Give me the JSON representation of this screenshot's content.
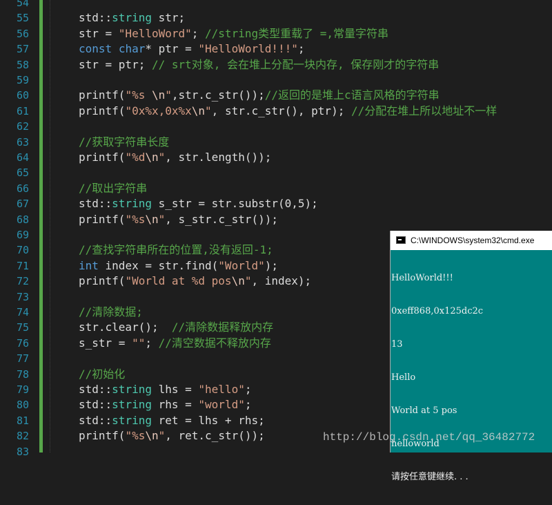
{
  "editor": {
    "line_numbers": [
      "54",
      "55",
      "56",
      "57",
      "58",
      "59",
      "60",
      "61",
      "62",
      "63",
      "64",
      "65",
      "66",
      "67",
      "68",
      "69",
      "70",
      "71",
      "72",
      "73",
      "74",
      "75",
      "76",
      "77",
      "78",
      "79",
      "80",
      "81",
      "82",
      "83"
    ],
    "lines": [
      [
        {
          "t": "",
          "c": "tx"
        }
      ],
      [
        {
          "t": "std::",
          "c": "tx"
        },
        {
          "t": "string",
          "c": "ty"
        },
        {
          "t": " str;",
          "c": "tx"
        }
      ],
      [
        {
          "t": "str = ",
          "c": "tx"
        },
        {
          "t": "\"HelloWord\"",
          "c": "str"
        },
        {
          "t": "; ",
          "c": "tx"
        },
        {
          "t": "//string类型重载了 =,常量字符串",
          "c": "cm"
        }
      ],
      [
        {
          "t": "const",
          "c": "kw"
        },
        {
          "t": " ",
          "c": "tx"
        },
        {
          "t": "char",
          "c": "kw"
        },
        {
          "t": "* ptr = ",
          "c": "tx"
        },
        {
          "t": "\"HelloWorld!!!\"",
          "c": "str"
        },
        {
          "t": ";",
          "c": "tx"
        }
      ],
      [
        {
          "t": "str = ptr; ",
          "c": "tx"
        },
        {
          "t": "// srt对象, 会在堆上分配一块内存, 保存刚才的字符串",
          "c": "cm"
        }
      ],
      [
        {
          "t": "",
          "c": "tx"
        }
      ],
      [
        {
          "t": "printf(",
          "c": "tx"
        },
        {
          "t": "\"%s ",
          "c": "str"
        },
        {
          "t": "\\n",
          "c": "esc"
        },
        {
          "t": "\"",
          "c": "str"
        },
        {
          "t": ",str.c_str());",
          "c": "tx"
        },
        {
          "t": "//返回的是堆上c语言风格的字符串",
          "c": "cm"
        }
      ],
      [
        {
          "t": "printf(",
          "c": "tx"
        },
        {
          "t": "\"0x%x,0x%x",
          "c": "str"
        },
        {
          "t": "\\n",
          "c": "esc"
        },
        {
          "t": "\"",
          "c": "str"
        },
        {
          "t": ", str.c_str(), ptr); ",
          "c": "tx"
        },
        {
          "t": "//分配在堆上所以地址不一样",
          "c": "cm"
        }
      ],
      [
        {
          "t": "",
          "c": "tx"
        }
      ],
      [
        {
          "t": "//获取字符串长度",
          "c": "cm"
        }
      ],
      [
        {
          "t": "printf(",
          "c": "tx"
        },
        {
          "t": "\"%d",
          "c": "str"
        },
        {
          "t": "\\n",
          "c": "esc"
        },
        {
          "t": "\"",
          "c": "str"
        },
        {
          "t": ", str.length());",
          "c": "tx"
        }
      ],
      [
        {
          "t": "",
          "c": "tx"
        }
      ],
      [
        {
          "t": "//取出字符串",
          "c": "cm"
        }
      ],
      [
        {
          "t": "std::",
          "c": "tx"
        },
        {
          "t": "string",
          "c": "ty"
        },
        {
          "t": " s_str = str.substr(0,5);",
          "c": "tx"
        }
      ],
      [
        {
          "t": "printf(",
          "c": "tx"
        },
        {
          "t": "\"%s",
          "c": "str"
        },
        {
          "t": "\\n",
          "c": "esc"
        },
        {
          "t": "\"",
          "c": "str"
        },
        {
          "t": ", s_str.c_str());",
          "c": "tx"
        }
      ],
      [
        {
          "t": "",
          "c": "tx"
        }
      ],
      [
        {
          "t": "//查找字符串所在的位置,没有返回-1;",
          "c": "cm"
        }
      ],
      [
        {
          "t": "int",
          "c": "kw"
        },
        {
          "t": " index = str.find(",
          "c": "tx"
        },
        {
          "t": "\"World\"",
          "c": "str"
        },
        {
          "t": ");",
          "c": "tx"
        }
      ],
      [
        {
          "t": "printf(",
          "c": "tx"
        },
        {
          "t": "\"World at %d pos",
          "c": "str"
        },
        {
          "t": "\\n",
          "c": "esc"
        },
        {
          "t": "\"",
          "c": "str"
        },
        {
          "t": ", index);",
          "c": "tx"
        }
      ],
      [
        {
          "t": "",
          "c": "tx"
        }
      ],
      [
        {
          "t": "//清除数据;",
          "c": "cm"
        }
      ],
      [
        {
          "t": "str.clear();  ",
          "c": "tx"
        },
        {
          "t": "//清除数据释放内存",
          "c": "cm"
        }
      ],
      [
        {
          "t": "s_str = ",
          "c": "tx"
        },
        {
          "t": "\"\"",
          "c": "str"
        },
        {
          "t": "; ",
          "c": "tx"
        },
        {
          "t": "//清空数据不释放内存",
          "c": "cm"
        }
      ],
      [
        {
          "t": "",
          "c": "tx"
        }
      ],
      [
        {
          "t": "//初始化",
          "c": "cm"
        }
      ],
      [
        {
          "t": "std::",
          "c": "tx"
        },
        {
          "t": "string",
          "c": "ty"
        },
        {
          "t": " lhs = ",
          "c": "tx"
        },
        {
          "t": "\"hello\"",
          "c": "str"
        },
        {
          "t": ";",
          "c": "tx"
        }
      ],
      [
        {
          "t": "std::",
          "c": "tx"
        },
        {
          "t": "string",
          "c": "ty"
        },
        {
          "t": " rhs = ",
          "c": "tx"
        },
        {
          "t": "\"world\"",
          "c": "str"
        },
        {
          "t": ";",
          "c": "tx"
        }
      ],
      [
        {
          "t": "std::",
          "c": "tx"
        },
        {
          "t": "string",
          "c": "ty"
        },
        {
          "t": " ret = lhs + rhs;",
          "c": "tx"
        }
      ],
      [
        {
          "t": "printf(",
          "c": "tx"
        },
        {
          "t": "\"%s",
          "c": "str"
        },
        {
          "t": "\\n",
          "c": "esc"
        },
        {
          "t": "\"",
          "c": "str"
        },
        {
          "t": ", ret.c_str());",
          "c": "tx"
        }
      ],
      [
        {
          "t": "",
          "c": "tx"
        }
      ]
    ]
  },
  "console": {
    "title": "C:\\WINDOWS\\system32\\cmd.exe",
    "icon": "console-icon",
    "output": [
      "HelloWorld!!!",
      "0xeff868,0x125dc2c",
      "13",
      "Hello",
      "World at 5 pos",
      "helloworld",
      "请按任意键继续. . ."
    ]
  },
  "watermark": "http://blog.csdn.net/qq_36482772",
  "colors": {
    "background": "#1e1e1e",
    "line_number": "#2b91af",
    "keyword": "#569cd6",
    "type": "#4ec9b0",
    "string": "#d69d85",
    "comment": "#57a64a",
    "console_bg": "#008080"
  }
}
